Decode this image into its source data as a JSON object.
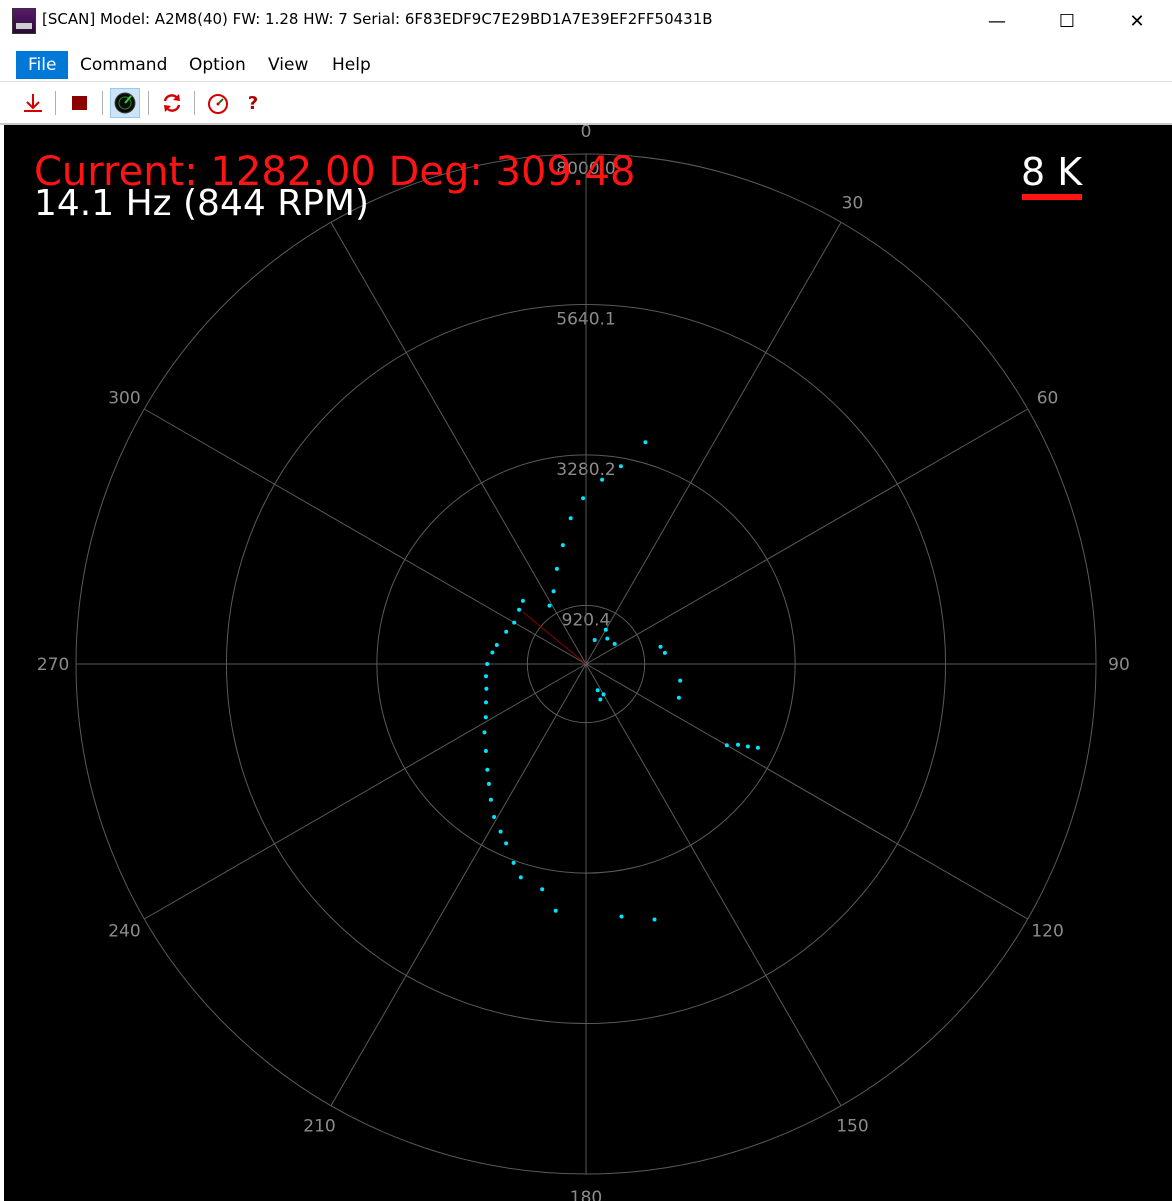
{
  "window": {
    "title": "[SCAN] Model: A2M8(40) FW: 1.28 HW: 7 Serial: 6F83EDF9C7E29BD1A7E39EF2FF50431B",
    "minimize_glyph": "—",
    "maximize_glyph": "☐",
    "close_glyph": "✕"
  },
  "menu": {
    "items": [
      {
        "label": "File",
        "active": true
      },
      {
        "label": "Command"
      },
      {
        "label": "Option"
      },
      {
        "label": "View"
      },
      {
        "label": "Help"
      }
    ]
  },
  "toolbar": {
    "buttons": [
      {
        "name": "download-icon",
        "color": "#d40000"
      },
      {
        "name": "stop-icon",
        "color": "#8b0000"
      },
      {
        "name": "scan-radar-icon",
        "pressed": true
      },
      {
        "name": "refresh-icon",
        "color": "#d40000"
      },
      {
        "name": "gauge-icon",
        "color": "#d40000"
      },
      {
        "name": "help-icon",
        "label": "?",
        "color": "#b00000"
      }
    ]
  },
  "hud": {
    "current": "Current: 1282.00 Deg: 309.48",
    "frequency": "14.1 Hz (844 RPM)",
    "scale_label": "8 K",
    "current_color": "#ff1414",
    "point_color": "#00e5ff"
  },
  "plot": {
    "max_distance": 8000,
    "ring_labels": [
      "920.4",
      "3280.2",
      "5640.1",
      "8000.0"
    ],
    "angle_labels": [
      {
        "deg": 0,
        "label": "0"
      },
      {
        "deg": 30,
        "label": "30"
      },
      {
        "deg": 60,
        "label": "60"
      },
      {
        "deg": 90,
        "label": "90"
      },
      {
        "deg": 120,
        "label": "120"
      },
      {
        "deg": 150,
        "label": "150"
      },
      {
        "deg": 180,
        "label": "180"
      },
      {
        "deg": 210,
        "label": "210"
      },
      {
        "deg": 240,
        "label": "240"
      },
      {
        "deg": 270,
        "label": "270"
      },
      {
        "deg": 300,
        "label": "300"
      }
    ],
    "current_ray": {
      "deg": 309.48,
      "distance": 1282.0
    }
  },
  "chart_data": {
    "type": "scatter",
    "title": "",
    "coordinate_system": "polar (angle deg, distance)",
    "rmax": 8000,
    "series": [
      {
        "points": [
          [
            315,
            1400
          ],
          [
            309,
            1350
          ],
          [
            300,
            1300
          ],
          [
            292,
            1350
          ],
          [
            282,
            1430
          ],
          [
            277,
            1480
          ],
          [
            270,
            1550
          ],
          [
            263,
            1580
          ],
          [
            256,
            1610
          ],
          [
            249,
            1680
          ],
          [
            242,
            1780
          ],
          [
            236,
            1920
          ],
          [
            229,
            2080
          ],
          [
            223,
            2270
          ],
          [
            219,
            2420
          ],
          [
            215,
            2600
          ],
          [
            211,
            2800
          ],
          [
            207,
            2950
          ],
          [
            204,
            3080
          ],
          [
            200,
            3320
          ],
          [
            197,
            3500
          ],
          [
            191,
            3600
          ],
          [
            187,
            3900
          ],
          [
            172,
            4000
          ],
          [
            165,
            4150
          ],
          [
            328,
            1080
          ],
          [
            336,
            1250
          ],
          [
            343,
            1560
          ],
          [
            349,
            1900
          ],
          [
            354,
            2300
          ],
          [
            359,
            2600
          ],
          [
            5,
            2900
          ],
          [
            10,
            3150
          ],
          [
            15,
            3600
          ],
          [
            20,
            400
          ],
          [
            30,
            620
          ],
          [
            40,
            520
          ],
          [
            55,
            550
          ],
          [
            77,
            1200
          ],
          [
            82,
            1250
          ],
          [
            150,
            550
          ],
          [
            156,
            450
          ],
          [
            158,
            600
          ],
          [
            100,
            1500
          ],
          [
            110,
            1550
          ],
          [
            120,
            2550
          ],
          [
            118,
            2700
          ],
          [
            117,
            2850
          ],
          [
            116,
            3000
          ]
        ]
      }
    ]
  }
}
